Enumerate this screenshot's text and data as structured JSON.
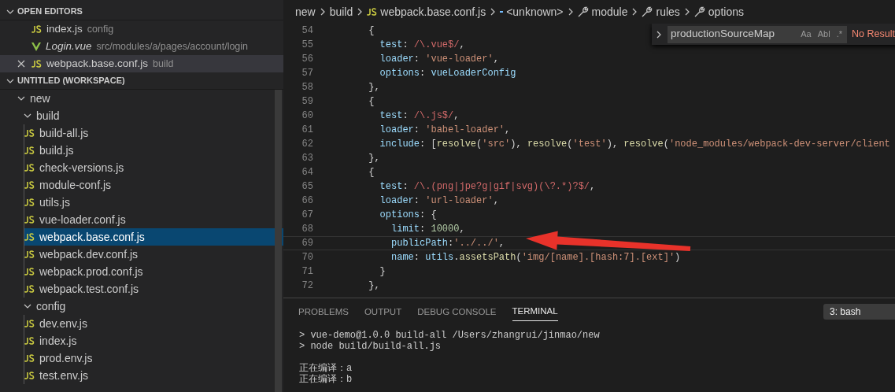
{
  "sidebar": {
    "open_editors": {
      "title": "OPEN EDITORS",
      "expanded": true,
      "items": [
        {
          "name": "index.js",
          "description": "config",
          "kind": "js",
          "preview": false,
          "selected": false
        },
        {
          "name": "Login.vue",
          "description": "src/modules/a/pages/account/login",
          "kind": "vue",
          "preview": true,
          "selected": false
        },
        {
          "name": "webpack.base.conf.js",
          "description": "build",
          "kind": "js",
          "preview": false,
          "selected": true
        }
      ]
    },
    "workspace": {
      "title": "UNTITLED (WORKSPACE)",
      "expanded": true,
      "tree": [
        {
          "label": "new",
          "kind": "folder",
          "expanded": true,
          "selected": false,
          "children": [
            {
              "label": "build",
              "kind": "folder",
              "expanded": true,
              "selected": false,
              "children": [
                {
                  "label": "build-all.js",
                  "kind": "js",
                  "selected": false
                },
                {
                  "label": "build.js",
                  "kind": "js",
                  "selected": false
                },
                {
                  "label": "check-versions.js",
                  "kind": "js",
                  "selected": false
                },
                {
                  "label": "module-conf.js",
                  "kind": "js",
                  "selected": false
                },
                {
                  "label": "utils.js",
                  "kind": "js",
                  "selected": false
                },
                {
                  "label": "vue-loader.conf.js",
                  "kind": "js",
                  "selected": false
                },
                {
                  "label": "webpack.base.conf.js",
                  "kind": "js",
                  "selected": true
                },
                {
                  "label": "webpack.dev.conf.js",
                  "kind": "js",
                  "selected": false
                },
                {
                  "label": "webpack.prod.conf.js",
                  "kind": "js",
                  "selected": false
                },
                {
                  "label": "webpack.test.conf.js",
                  "kind": "js",
                  "selected": false
                }
              ]
            },
            {
              "label": "config",
              "kind": "folder",
              "expanded": true,
              "selected": false,
              "children": [
                {
                  "label": "dev.env.js",
                  "kind": "js",
                  "selected": false
                },
                {
                  "label": "index.js",
                  "kind": "js",
                  "selected": false
                },
                {
                  "label": "prod.env.js",
                  "kind": "js",
                  "selected": false
                },
                {
                  "label": "test.env.js",
                  "kind": "js",
                  "selected": false
                }
              ]
            }
          ]
        }
      ]
    }
  },
  "breadcrumbs": [
    {
      "label": "new",
      "kind": "folder"
    },
    {
      "label": "build",
      "kind": "folder"
    },
    {
      "label": "webpack.base.conf.js",
      "kind": "js"
    },
    {
      "label": "<unknown>",
      "kind": "symbol"
    },
    {
      "label": "module",
      "kind": "property"
    },
    {
      "label": "rules",
      "kind": "property"
    },
    {
      "label": "options",
      "kind": "property"
    }
  ],
  "find_widget": {
    "value": "productionSourceMap",
    "toggles": [
      "Aa",
      "Abl",
      ".*"
    ],
    "result": "No Result"
  },
  "code": [
    {
      "number": "54",
      "current": false,
      "tokens": [
        {
          "kind": "punct",
          "text": "      {"
        }
      ]
    },
    {
      "number": "55",
      "current": false,
      "tokens": [
        {
          "kind": "prop",
          "text": "        test"
        },
        {
          "kind": "punct",
          "text": ": "
        },
        {
          "kind": "regex",
          "text": "/\\.vue$/"
        },
        {
          "kind": "punct",
          "text": ","
        }
      ]
    },
    {
      "number": "56",
      "current": false,
      "tokens": [
        {
          "kind": "prop",
          "text": "        loader"
        },
        {
          "kind": "punct",
          "text": ": "
        },
        {
          "kind": "string",
          "text": "'vue-loader'"
        },
        {
          "kind": "punct",
          "text": ","
        }
      ]
    },
    {
      "number": "57",
      "current": false,
      "tokens": [
        {
          "kind": "prop",
          "text": "        options"
        },
        {
          "kind": "punct",
          "text": ": "
        },
        {
          "kind": "var",
          "text": "vueLoaderConfig"
        }
      ]
    },
    {
      "number": "58",
      "current": false,
      "tokens": [
        {
          "kind": "punct",
          "text": "      },"
        }
      ]
    },
    {
      "number": "59",
      "current": false,
      "tokens": [
        {
          "kind": "punct",
          "text": "      {"
        }
      ]
    },
    {
      "number": "60",
      "current": false,
      "tokens": [
        {
          "kind": "prop",
          "text": "        test"
        },
        {
          "kind": "punct",
          "text": ": "
        },
        {
          "kind": "regex",
          "text": "/\\.js$/"
        },
        {
          "kind": "punct",
          "text": ","
        }
      ]
    },
    {
      "number": "61",
      "current": false,
      "tokens": [
        {
          "kind": "prop",
          "text": "        loader"
        },
        {
          "kind": "punct",
          "text": ": "
        },
        {
          "kind": "string",
          "text": "'babel-loader'"
        },
        {
          "kind": "punct",
          "text": ","
        }
      ]
    },
    {
      "number": "62",
      "current": false,
      "tokens": [
        {
          "kind": "prop",
          "text": "        include"
        },
        {
          "kind": "punct",
          "text": ": ["
        },
        {
          "kind": "func",
          "text": "resolve"
        },
        {
          "kind": "punct",
          "text": "("
        },
        {
          "kind": "string",
          "text": "'src'"
        },
        {
          "kind": "punct",
          "text": "), "
        },
        {
          "kind": "func",
          "text": "resolve"
        },
        {
          "kind": "punct",
          "text": "("
        },
        {
          "kind": "string",
          "text": "'test'"
        },
        {
          "kind": "punct",
          "text": "), "
        },
        {
          "kind": "func",
          "text": "resolve"
        },
        {
          "kind": "punct",
          "text": "("
        },
        {
          "kind": "string",
          "text": "'node_modules/webpack-dev-server/client"
        }
      ]
    },
    {
      "number": "63",
      "current": false,
      "tokens": [
        {
          "kind": "punct",
          "text": "      },"
        }
      ]
    },
    {
      "number": "64",
      "current": false,
      "tokens": [
        {
          "kind": "punct",
          "text": "      {"
        }
      ]
    },
    {
      "number": "65",
      "current": false,
      "tokens": [
        {
          "kind": "prop",
          "text": "        test"
        },
        {
          "kind": "punct",
          "text": ": "
        },
        {
          "kind": "regex",
          "text": "/\\.(png|jpe?g|gif|svg)(\\?.*)?$/"
        },
        {
          "kind": "punct",
          "text": ","
        }
      ]
    },
    {
      "number": "66",
      "current": false,
      "tokens": [
        {
          "kind": "prop",
          "text": "        loader"
        },
        {
          "kind": "punct",
          "text": ": "
        },
        {
          "kind": "string",
          "text": "'url-loader'"
        },
        {
          "kind": "punct",
          "text": ","
        }
      ]
    },
    {
      "number": "67",
      "current": false,
      "tokens": [
        {
          "kind": "prop",
          "text": "        options"
        },
        {
          "kind": "punct",
          "text": ": {"
        }
      ]
    },
    {
      "number": "68",
      "current": false,
      "tokens": [
        {
          "kind": "prop",
          "text": "          limit"
        },
        {
          "kind": "punct",
          "text": ": "
        },
        {
          "kind": "number",
          "text": "10000"
        },
        {
          "kind": "punct",
          "text": ","
        }
      ]
    },
    {
      "number": "69",
      "current": true,
      "tokens": [
        {
          "kind": "prop",
          "text": "          publicPath"
        },
        {
          "kind": "punct",
          "text": ":"
        },
        {
          "kind": "string",
          "text": "'../../'"
        },
        {
          "kind": "punct",
          "text": ","
        }
      ]
    },
    {
      "number": "70",
      "current": false,
      "tokens": [
        {
          "kind": "prop",
          "text": "          name"
        },
        {
          "kind": "punct",
          "text": ": "
        },
        {
          "kind": "var",
          "text": "utils"
        },
        {
          "kind": "punct",
          "text": "."
        },
        {
          "kind": "func",
          "text": "assetsPath"
        },
        {
          "kind": "punct",
          "text": "("
        },
        {
          "kind": "string",
          "text": "'img/[name].[hash:7].[ext]'"
        },
        {
          "kind": "punct",
          "text": ")"
        }
      ]
    },
    {
      "number": "71",
      "current": false,
      "tokens": [
        {
          "kind": "punct",
          "text": "        }"
        }
      ]
    },
    {
      "number": "72",
      "current": false,
      "tokens": [
        {
          "kind": "punct",
          "text": "      },"
        }
      ]
    }
  ],
  "panel": {
    "tabs": [
      {
        "label": "PROBLEMS",
        "selected": false
      },
      {
        "label": "OUTPUT",
        "selected": false
      },
      {
        "label": "DEBUG CONSOLE",
        "selected": false
      },
      {
        "label": "TERMINAL",
        "selected": true
      }
    ],
    "terminal_picker": "3: bash",
    "terminal_blocks": [
      [
        "> vue-demo@1.0.0 build-all /Users/zhangrui/jinmao/new",
        "> node build/build-all.js"
      ],
      [
        "正在编译：a",
        "正在编译：b"
      ]
    ]
  }
}
